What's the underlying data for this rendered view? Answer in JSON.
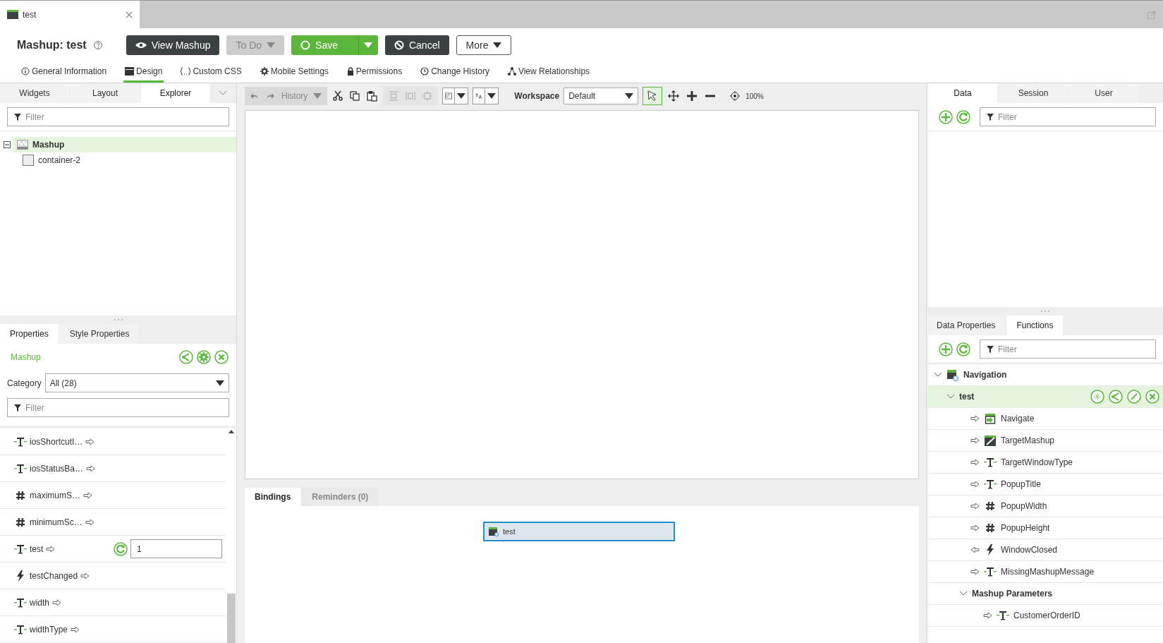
{
  "browser_tab": {
    "title": "test"
  },
  "header": {
    "title": "Mashup: test",
    "buttons": [
      {
        "label": "View Mashup",
        "kind": "dark",
        "caret": false
      },
      {
        "label": "To Do",
        "kind": "disabled",
        "caret": true
      },
      {
        "label": "Save",
        "kind": "primary",
        "caret": true
      },
      {
        "label": "Cancel",
        "kind": "dark",
        "caret": false
      },
      {
        "label": "More",
        "kind": "outline",
        "caret": true
      }
    ]
  },
  "nav_tabs": [
    {
      "label": "General Information",
      "selected": false
    },
    {
      "label": "Design",
      "selected": true
    },
    {
      "label": "Custom CSS",
      "selected": false
    },
    {
      "label": "Mobile Settings",
      "selected": false
    },
    {
      "label": "Permissions",
      "selected": false
    },
    {
      "label": "Change History",
      "selected": false
    },
    {
      "label": "View Relationships",
      "selected": false
    }
  ],
  "left_panel": {
    "tabs": [
      {
        "label": "Widgets",
        "selected": false
      },
      {
        "label": "Layout",
        "selected": false
      },
      {
        "label": "Explorer",
        "selected": true
      }
    ],
    "filter": {
      "placeholder": "Filter"
    },
    "tree": [
      {
        "label": "Mashup",
        "selected": true,
        "expanded": true,
        "children": [
          {
            "label": "container-2",
            "selected": false
          }
        ]
      }
    ]
  },
  "properties_panel": {
    "tabs": [
      {
        "label": "Properties",
        "selected": true
      },
      {
        "label": "Style Properties",
        "selected": false
      }
    ],
    "target": "Mashup",
    "category_label": "Category",
    "category_value": "All (28)",
    "filter": {
      "placeholder": "Filter"
    },
    "rows": [
      {
        "kind": "string",
        "name": "iosShortcutI…"
      },
      {
        "kind": "string",
        "name": "iosStatusBa…"
      },
      {
        "kind": "number",
        "name": "maximumS…"
      },
      {
        "kind": "number",
        "name": "minimumSc…"
      },
      {
        "kind": "string",
        "name": "test",
        "value": "1"
      },
      {
        "kind": "event",
        "name": "testChanged"
      },
      {
        "kind": "string",
        "name": "width"
      },
      {
        "kind": "string",
        "name": "widthType"
      }
    ]
  },
  "toolbar": {
    "history": "History",
    "workspace_label": "Workspace",
    "workspace_value": "Default",
    "zoom": "100%"
  },
  "bindings": {
    "tabs": [
      {
        "label": "Bindings",
        "selected": true
      },
      {
        "label": "Reminders (0)",
        "selected": false
      }
    ],
    "widget": "test"
  },
  "data_panel": {
    "tabs": [
      {
        "label": "Data",
        "selected": true
      },
      {
        "label": "Session",
        "selected": false
      },
      {
        "label": "User",
        "selected": false
      }
    ],
    "filter": {
      "placeholder": "Filter"
    }
  },
  "functions_panel": {
    "tabs": [
      {
        "label": "Data Properties",
        "selected": false
      },
      {
        "label": "Functions",
        "selected": true
      }
    ],
    "filter": {
      "placeholder": "Filter"
    },
    "tree": [
      {
        "kind": "service",
        "label": "Navigation",
        "expanded": true,
        "selected": false,
        "children": [
          {
            "kind": "instance",
            "label": "test",
            "expanded": true,
            "selected": true,
            "children": [
              {
                "kind": "navigate",
                "inbound": false,
                "label": "Navigate"
              },
              {
                "kind": "mashup",
                "inbound": false,
                "label": "TargetMashup"
              },
              {
                "kind": "string",
                "inbound": false,
                "label": "TargetWindowType"
              },
              {
                "kind": "string",
                "inbound": false,
                "label": "PopupTitle"
              },
              {
                "kind": "number",
                "inbound": false,
                "label": "PopupWidth"
              },
              {
                "kind": "number",
                "inbound": false,
                "label": "PopupHeight"
              },
              {
                "kind": "event",
                "inbound": true,
                "label": "WindowClosed"
              },
              {
                "kind": "string",
                "inbound": false,
                "label": "MissingMashupMessage"
              },
              {
                "kind": "folder",
                "label": "Mashup Parameters",
                "expanded": true,
                "selected": false,
                "children": [
                  {
                    "kind": "string",
                    "inbound": false,
                    "label": "CustomerOrderID"
                  }
                ]
              }
            ]
          }
        ]
      }
    ]
  }
}
